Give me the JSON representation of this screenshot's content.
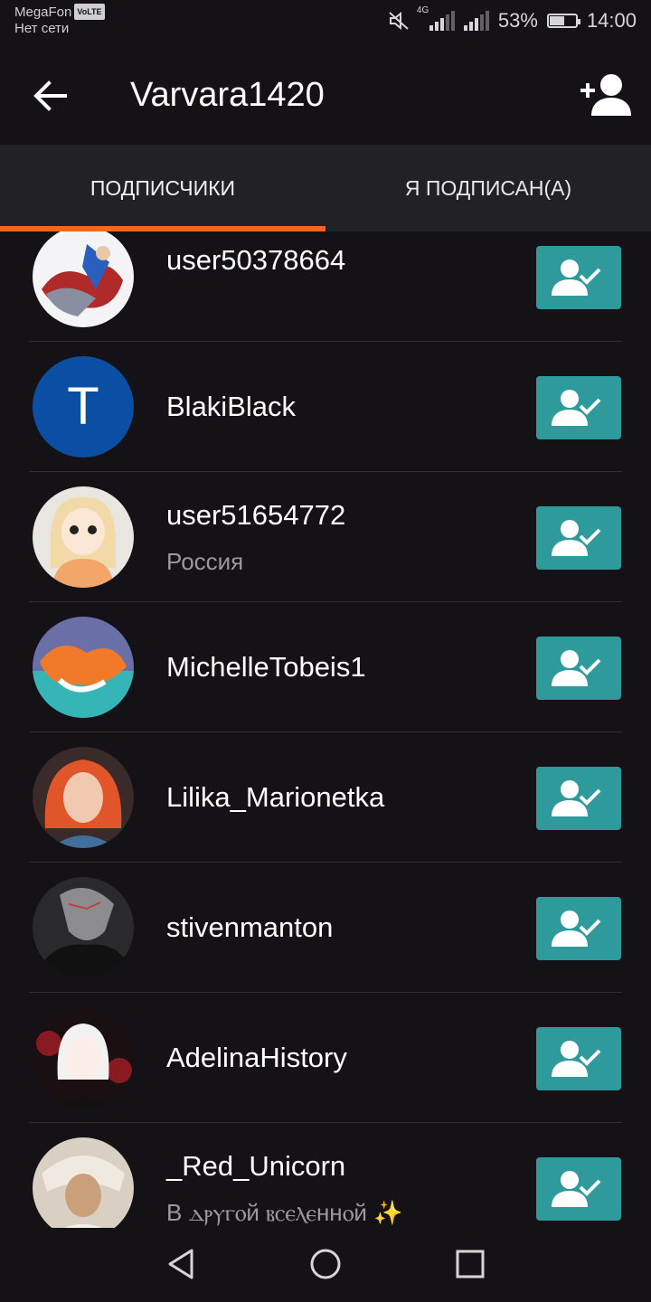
{
  "status_bar": {
    "carrier": "MegaFon",
    "volte": "VoLTE",
    "network_status": "Нет сети",
    "network_type": "4G",
    "battery": "53%",
    "battery_level": 0.53,
    "time": "14:00"
  },
  "app_bar": {
    "title": "Varvara1420",
    "back_icon": "back-arrow-icon",
    "add_icon": "add-user-icon"
  },
  "tabs": [
    {
      "label": "ПОДПИСЧИКИ",
      "active": true
    },
    {
      "label": "Я ПОДПИСАН(А)",
      "active": false
    }
  ],
  "accent_color": "#f26522",
  "button_color": "#2f9a9c",
  "users": [
    {
      "name": "user50378664",
      "subtitle": ""
    },
    {
      "name": "BlakiBlack",
      "subtitle": "",
      "avatar_letter": "T"
    },
    {
      "name": "user51654772",
      "subtitle": "Россия"
    },
    {
      "name": "MichelleTobeis1",
      "subtitle": ""
    },
    {
      "name": "Lilika_Marionetka",
      "subtitle": ""
    },
    {
      "name": "stivenmanton",
      "subtitle": ""
    },
    {
      "name": "AdelinaHistory",
      "subtitle": ""
    },
    {
      "name": "_Red_Unicorn",
      "subtitle": "В ⲇⲣⲩⲅⲟй ⲃⲥⲉⲗⲉннⲟй ✨"
    }
  ],
  "nav_bar": {
    "back": "nav-back-icon",
    "home": "nav-home-icon",
    "recents": "nav-recents-icon"
  }
}
